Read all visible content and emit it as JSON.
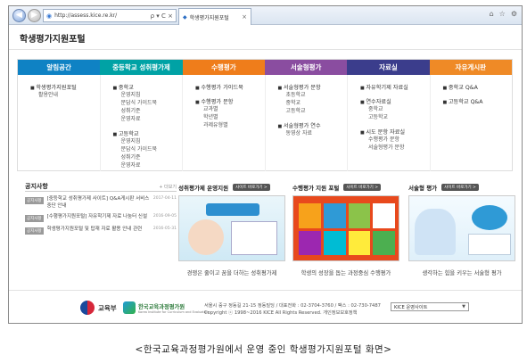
{
  "browser": {
    "url": "http://assess.kice.re.kr/",
    "tab_title": "학생평가지원포털",
    "address_controls": "ρ ▾ C ×"
  },
  "site": {
    "title": "학생평가지원포털"
  },
  "menu": {
    "tabs": [
      {
        "label": "알림공간",
        "color": "#0f82c4"
      },
      {
        "label": "중등학교 성취평가제",
        "color": "#00a2a5"
      },
      {
        "label": "수행평가",
        "color": "#ef7d1b"
      },
      {
        "label": "서술형평가",
        "color": "#8a4da0"
      },
      {
        "label": "자료실",
        "color": "#3b3d8c"
      },
      {
        "label": "자유게시판",
        "color": "#ef8a26"
      }
    ],
    "columns": [
      [
        {
          "head": "학생평가지원포털",
          "subs": [
            "활용안내"
          ]
        }
      ],
      [
        {
          "head": "중학교",
          "subs": [
            "운영지침",
            "문답식 가이드북",
            "성취기준",
            "운영자료"
          ]
        },
        {
          "head": "고등학교",
          "subs": [
            "운영지침",
            "문답식 가이드북",
            "성취기준",
            "운영자료"
          ]
        }
      ],
      [
        {
          "head": "수행평가 가이드북",
          "subs": []
        },
        {
          "head": "수행평가 문항",
          "subs": [
            "교과별",
            "학년별",
            "과제유형별"
          ]
        }
      ],
      [
        {
          "head": "서술형평가 문항",
          "subs": [
            "초등학교",
            "중학교",
            "고등학교"
          ]
        },
        {
          "head": "서술형평가 연수",
          "subs": [
            "동영상 자료"
          ]
        }
      ],
      [
        {
          "head": "자유학기제 자료실",
          "subs": []
        },
        {
          "head": "연수자료실",
          "subs": [
            "중학교",
            "고등학교"
          ]
        },
        {
          "head": "시도 문항 자료실",
          "subs": [
            "수행평가 문항",
            "서술형평가 문항"
          ]
        }
      ],
      [
        {
          "head": "중학교 Q&A",
          "subs": []
        },
        {
          "head": "고등학교 Q&A",
          "subs": []
        }
      ]
    ]
  },
  "news": {
    "title": "공지사항",
    "more": "+ 더보기",
    "items": [
      {
        "badge": "공지사항",
        "text": "[중등학교 성취평가제 사이트] Q&A게시판 서비스 중단 안내",
        "date": "2017-04-11"
      },
      {
        "badge": "공지사항",
        "text": "[수행평가지원포털] 자유학기제 자료 나눔터 신설",
        "date": "2016-09-05"
      },
      {
        "badge": "공지사항",
        "text": "학생평가지원포털 및 탑재 자료 활용 안내 관련",
        "date": "2016-05-31"
      }
    ]
  },
  "panels": [
    {
      "title": "성취평가제 운영지원",
      "btn": "사이트 바로가기 >",
      "caption": "경쟁은 줄이고 꿈을 더하는 성취평가제"
    },
    {
      "title": "수행평가 지원 포털",
      "btn": "사이트 바로가기 >",
      "caption": "학생의 성장을 돕는 과정중심 수행평가"
    },
    {
      "title": "서술형 평가",
      "btn": "사이트 바로가기 >",
      "caption": "생각하는 힘을 키우는 서술형 평가"
    }
  ],
  "footer": {
    "logo1": "교육부",
    "logo2_ko": "한국교육과정평가원",
    "logo2_en": "Korea Institute for Curriculum and Evaluation",
    "address": "서울시 중구 정동길 21-15 정동빌딩 / 대표전화 : 02-3704-3760 / 팩스 : 02-730-7487",
    "copyright": "Copyright ⓒ 1998~2016 KICE All Rights Reserved. 개인정보보호정책",
    "select_value": "KICE 운영사이트"
  },
  "caption": "<한국교육과정평가원에서 운영 중인 학생평가지원포털 화면>"
}
